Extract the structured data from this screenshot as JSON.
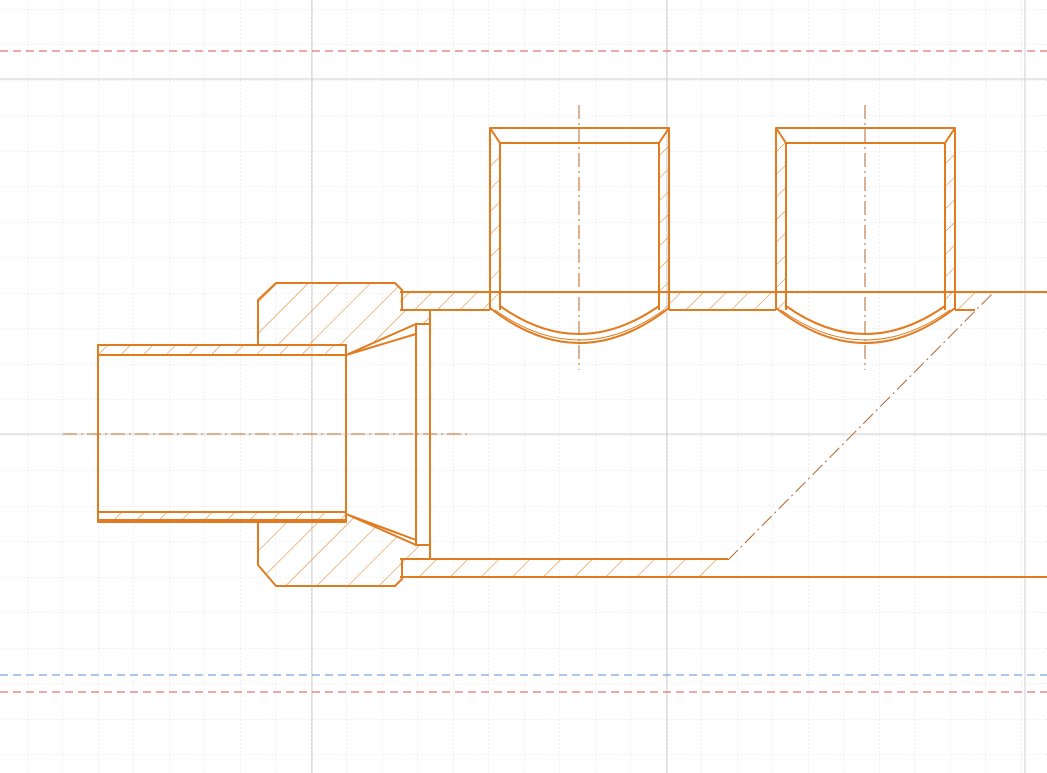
{
  "canvas": {
    "background": "#ffffff",
    "grid_minor_color": "#d9d9d9",
    "grid_major_color": "#cfcfcf"
  },
  "drawing": {
    "stroke_color": "#e07b1f",
    "centerline_color": "#b5652a",
    "guide_red_color": "#d9534f",
    "guide_blue_color": "#5b8fd6",
    "text_labels": []
  }
}
